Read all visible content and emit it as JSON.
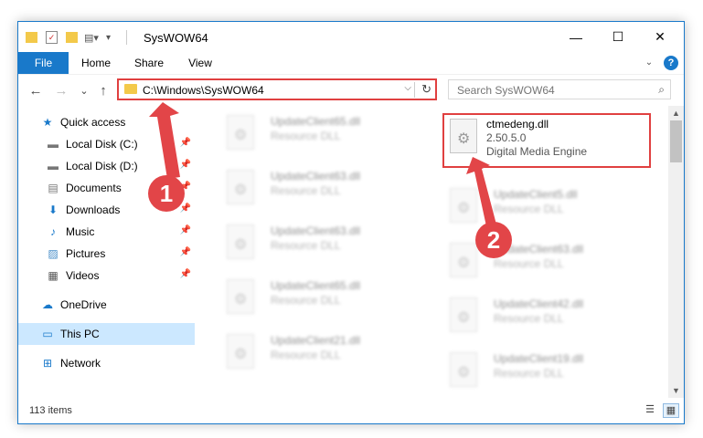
{
  "window": {
    "title": "SysWOW64"
  },
  "window_controls": {
    "minimize": "—",
    "maximize": "☐",
    "close": "✕"
  },
  "ribbon": {
    "tabs": [
      "File",
      "Home",
      "Share",
      "View"
    ],
    "help": "?"
  },
  "navigation": {
    "back": "←",
    "forward": "→",
    "recent": "⌄",
    "up": "↑",
    "address": "C:\\Windows\\SysWOW64",
    "address_dropdown": "⌵",
    "refresh": "↻",
    "search_placeholder": "Search SysWOW64",
    "search_icon": "⌕"
  },
  "sidebar": {
    "items": [
      {
        "label": "Quick access",
        "icon": "star-icon",
        "glyph": "★"
      },
      {
        "label": "Local Disk (C:)",
        "icon": "drive-icon",
        "glyph": "▬",
        "pinned": true
      },
      {
        "label": "Local Disk (D:)",
        "icon": "drive-icon",
        "glyph": "▬",
        "pinned": true
      },
      {
        "label": "Documents",
        "icon": "documents-icon",
        "glyph": "▤",
        "pinned": true
      },
      {
        "label": "Downloads",
        "icon": "downloads-icon",
        "glyph": "⬇",
        "pinned": true
      },
      {
        "label": "Music",
        "icon": "music-icon",
        "glyph": "♪",
        "pinned": true
      },
      {
        "label": "Pictures",
        "icon": "pictures-icon",
        "glyph": "▨",
        "pinned": true
      },
      {
        "label": "Videos",
        "icon": "videos-icon",
        "glyph": "▦",
        "pinned": true
      },
      {
        "label": "OneDrive",
        "icon": "onedrive-icon",
        "glyph": "☁"
      },
      {
        "label": "This PC",
        "icon": "computer-icon",
        "glyph": "▭",
        "selected": true
      },
      {
        "label": "Network",
        "icon": "network-icon",
        "glyph": "⊞"
      }
    ],
    "pin_glyph": "📌"
  },
  "files": [
    {
      "name": "UpdateClient65.dll",
      "type": "Resource DLL"
    },
    {
      "name": "UpdateClient63.dll",
      "type": "Resource DLL"
    },
    {
      "name": "UpdateClient5.dll",
      "type": "Resource DLL"
    },
    {
      "name": "UpdateClient63.dll",
      "type": "Resource DLL"
    },
    {
      "name": "UpdateClient63.dll",
      "type": "Resource DLL"
    },
    {
      "name": "UpdateClient65.dll",
      "type": "Resource DLL"
    },
    {
      "name": "UpdateClient42.dll",
      "type": "Resource DLL"
    },
    {
      "name": "UpdateClient21.dll",
      "type": "Resource DLL"
    },
    {
      "name": "UpdateClient19.dll",
      "type": "Resource DLL"
    }
  ],
  "highlighted_file": {
    "name": "ctmedeng.dll",
    "version": "2.50.5.0",
    "description": "Digital Media Engine"
  },
  "status": {
    "item_count": "113 items"
  },
  "annotations": {
    "step1": "1",
    "step2": "2",
    "color": "#e24548"
  },
  "colors": {
    "accent": "#1979ca",
    "highlight_border": "#e04040",
    "selected_bg": "#cce8ff"
  }
}
